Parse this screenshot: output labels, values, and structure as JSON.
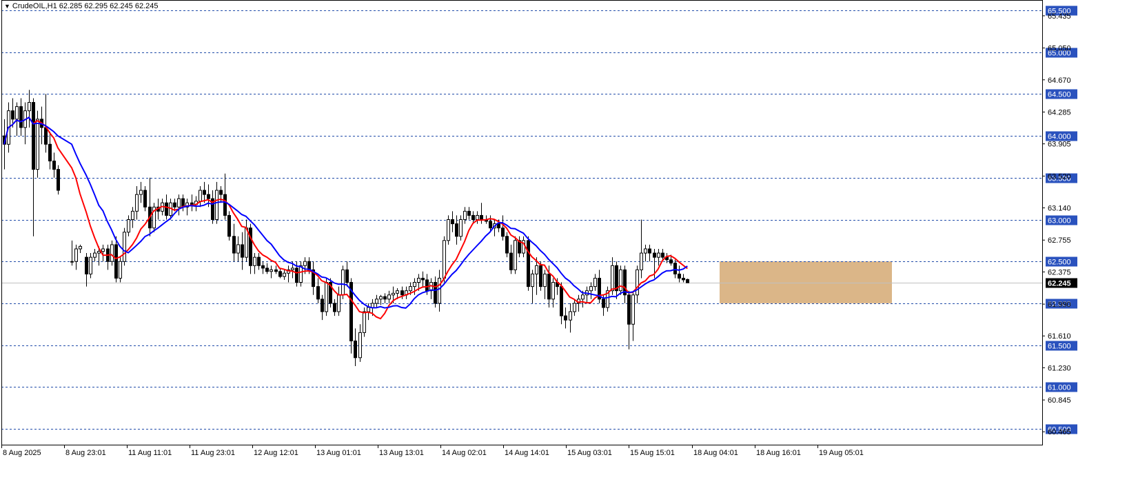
{
  "header": {
    "symbol": "CrudeOIL,H1",
    "ohlc": "62.285 62.295 62.245 62.245"
  },
  "colors": {
    "ma_fast": "#ff0000",
    "ma_slow": "#0000ff",
    "level_line": "#1f4aa8",
    "level_label_bg": "#2a52be",
    "price_line": "#c0c0c0",
    "price_label_bg": "#000000",
    "zone": "#d2a46a"
  },
  "chart_data": {
    "type": "candlestick",
    "symbol": "CrudeOIL",
    "timeframe": "H1",
    "y_range": [
      60.5,
      65.5
    ],
    "current_price": "62.245",
    "y_ticks": [
      "65.435",
      "65.050",
      "64.670",
      "64.285",
      "63.905",
      "63.520",
      "63.140",
      "62.755",
      "62.375",
      "61.990",
      "61.610",
      "61.230",
      "60.845",
      "60.465"
    ],
    "horizontal_levels": [
      "65.500",
      "65.000",
      "64.500",
      "64.000",
      "63.500",
      "63.000",
      "62.500",
      "62.000",
      "61.500",
      "61.000",
      "60.500"
    ],
    "x_labels": [
      "8 Aug 2025",
      "8 Aug 23:01",
      "11 Aug 11:01",
      "11 Aug 23:01",
      "12 Aug 12:01",
      "13 Aug 01:01",
      "13 Aug 13:01",
      "14 Aug 02:01",
      "14 Aug 14:01",
      "15 Aug 03:01",
      "15 Aug 15:01",
      "18 Aug 04:01",
      "18 Aug 16:01",
      "19 Aug 05:01"
    ],
    "candles": [
      [
        64.0,
        64.2,
        63.6,
        63.9
      ],
      [
        63.9,
        64.4,
        63.8,
        64.3
      ],
      [
        64.3,
        64.45,
        64.1,
        64.2
      ],
      [
        64.2,
        64.4,
        64.0,
        64.35
      ],
      [
        64.35,
        64.45,
        64.0,
        64.1
      ],
      [
        64.1,
        64.4,
        63.9,
        64.3
      ],
      [
        64.3,
        64.55,
        64.1,
        64.4
      ],
      [
        64.4,
        64.45,
        62.8,
        63.6
      ],
      [
        63.6,
        64.3,
        63.5,
        64.2
      ],
      [
        64.2,
        64.35,
        63.9,
        64.1
      ],
      [
        64.1,
        64.5,
        63.8,
        63.9
      ],
      [
        63.9,
        64.05,
        63.6,
        63.7
      ],
      [
        63.7,
        63.8,
        63.5,
        63.6
      ],
      [
        63.6,
        63.65,
        63.3,
        63.35
      ],
      [
        62.5,
        62.75,
        62.45,
        62.5
      ],
      [
        62.5,
        62.7,
        62.4,
        62.65
      ],
      [
        62.65,
        62.7,
        62.6,
        62.68
      ],
      [
        62.55,
        62.6,
        62.2,
        62.35
      ],
      [
        62.35,
        62.6,
        62.3,
        62.55
      ],
      [
        62.55,
        62.65,
        62.5,
        62.6
      ],
      [
        62.6,
        62.68,
        62.45,
        62.62
      ],
      [
        62.62,
        62.7,
        62.5,
        62.65
      ],
      [
        62.65,
        62.7,
        62.4,
        62.5
      ],
      [
        62.5,
        62.75,
        62.45,
        62.7
      ],
      [
        62.7,
        62.8,
        62.25,
        62.3
      ],
      [
        62.3,
        62.55,
        62.25,
        62.5
      ],
      [
        62.5,
        62.9,
        62.45,
        62.85
      ],
      [
        62.85,
        63.05,
        62.8,
        63.0
      ],
      [
        63.0,
        63.15,
        62.9,
        63.1
      ],
      [
        63.1,
        63.4,
        63.0,
        63.3
      ],
      [
        63.3,
        63.45,
        63.2,
        63.35
      ],
      [
        63.35,
        63.4,
        63.1,
        63.15
      ],
      [
        63.15,
        63.5,
        62.8,
        62.9
      ],
      [
        62.9,
        63.2,
        62.85,
        63.15
      ],
      [
        63.15,
        63.25,
        63.0,
        63.1
      ],
      [
        63.1,
        63.25,
        63.05,
        63.2
      ],
      [
        63.2,
        63.3,
        63.0,
        63.05
      ],
      [
        63.05,
        63.25,
        63.0,
        63.2
      ],
      [
        63.2,
        63.25,
        63.1,
        63.15
      ],
      [
        63.15,
        63.3,
        63.05,
        63.25
      ],
      [
        63.25,
        63.3,
        63.1,
        63.15
      ],
      [
        63.15,
        63.25,
        63.05,
        63.2
      ],
      [
        63.2,
        63.3,
        63.1,
        63.18
      ],
      [
        63.18,
        63.28,
        63.1,
        63.22
      ],
      [
        63.22,
        63.4,
        63.15,
        63.35
      ],
      [
        63.35,
        63.45,
        63.2,
        63.3
      ],
      [
        63.3,
        63.42,
        63.15,
        63.25
      ],
      [
        63.25,
        63.35,
        62.95,
        63.0
      ],
      [
        63.0,
        63.45,
        62.95,
        63.35
      ],
      [
        63.35,
        63.4,
        63.2,
        63.3
      ],
      [
        63.3,
        63.55,
        63.0,
        63.05
      ],
      [
        63.05,
        63.1,
        62.75,
        62.8
      ],
      [
        62.8,
        62.95,
        62.5,
        62.6
      ],
      [
        62.6,
        62.8,
        62.5,
        62.7
      ],
      [
        62.7,
        62.85,
        62.4,
        62.55
      ],
      [
        62.55,
        63.0,
        62.5,
        62.9
      ],
      [
        62.9,
        62.95,
        62.35,
        62.45
      ],
      [
        62.45,
        62.6,
        62.35,
        62.55
      ],
      [
        62.55,
        62.6,
        62.4,
        62.45
      ],
      [
        62.45,
        62.5,
        62.35,
        62.42
      ],
      [
        62.42,
        62.48,
        62.35,
        62.38
      ],
      [
        62.38,
        62.45,
        62.3,
        62.4
      ],
      [
        62.4,
        62.45,
        62.35,
        62.38
      ],
      [
        62.38,
        62.42,
        62.3,
        62.32
      ],
      [
        62.32,
        62.4,
        62.28,
        62.36
      ],
      [
        62.36,
        62.45,
        62.25,
        62.4
      ],
      [
        62.4,
        62.5,
        62.3,
        62.42
      ],
      [
        62.42,
        62.5,
        62.2,
        62.25
      ],
      [
        62.25,
        62.5,
        62.2,
        62.45
      ],
      [
        62.45,
        62.55,
        62.35,
        62.5
      ],
      [
        62.5,
        62.55,
        62.35,
        62.4
      ],
      [
        62.4,
        62.5,
        62.1,
        62.2
      ],
      [
        62.2,
        62.3,
        62.0,
        62.05
      ],
      [
        62.05,
        62.1,
        61.8,
        61.9
      ],
      [
        61.9,
        62.3,
        61.85,
        62.25
      ],
      [
        62.25,
        62.3,
        61.95,
        62.0
      ],
      [
        62.0,
        62.05,
        61.85,
        61.9
      ],
      [
        61.9,
        62.2,
        61.85,
        62.1
      ],
      [
        62.1,
        62.45,
        62.05,
        62.4
      ],
      [
        62.4,
        62.5,
        62.2,
        62.25
      ],
      [
        62.25,
        62.3,
        61.4,
        61.55
      ],
      [
        61.55,
        61.7,
        61.25,
        61.35
      ],
      [
        61.35,
        61.75,
        61.3,
        61.65
      ],
      [
        61.65,
        61.95,
        61.6,
        61.9
      ],
      [
        61.9,
        62.0,
        61.8,
        61.95
      ],
      [
        61.95,
        62.05,
        61.85,
        62.0
      ],
      [
        62.0,
        62.1,
        61.95,
        62.05
      ],
      [
        62.05,
        62.1,
        61.98,
        62.08
      ],
      [
        62.08,
        62.12,
        62.0,
        62.05
      ],
      [
        62.05,
        62.15,
        62.0,
        62.1
      ],
      [
        62.1,
        62.2,
        62.0,
        62.12
      ],
      [
        62.12,
        62.18,
        62.05,
        62.15
      ],
      [
        62.15,
        62.2,
        62.05,
        62.1
      ],
      [
        62.1,
        62.2,
        62.05,
        62.15
      ],
      [
        62.15,
        62.25,
        62.1,
        62.2
      ],
      [
        62.2,
        62.3,
        62.1,
        62.25
      ],
      [
        62.25,
        62.35,
        62.15,
        62.3
      ],
      [
        62.3,
        62.38,
        62.2,
        62.28
      ],
      [
        62.28,
        62.35,
        62.1,
        62.15
      ],
      [
        62.15,
        62.3,
        62.05,
        62.25
      ],
      [
        62.25,
        62.32,
        61.95,
        62.0
      ],
      [
        62.0,
        62.4,
        61.9,
        62.3
      ],
      [
        62.3,
        62.8,
        62.25,
        62.75
      ],
      [
        62.75,
        63.05,
        62.7,
        63.0
      ],
      [
        63.0,
        63.1,
        62.85,
        62.95
      ],
      [
        62.95,
        63.05,
        62.7,
        62.8
      ],
      [
        62.8,
        63.05,
        62.75,
        63.0
      ],
      [
        63.0,
        63.15,
        62.95,
        63.1
      ],
      [
        63.1,
        63.15,
        63.0,
        63.05
      ],
      [
        63.05,
        63.1,
        62.95,
        63.0
      ],
      [
        63.0,
        63.1,
        62.95,
        63.05
      ],
      [
        63.05,
        63.2,
        62.95,
        63.0
      ],
      [
        63.0,
        63.05,
        62.95,
        62.98
      ],
      [
        62.98,
        63.05,
        62.85,
        62.9
      ],
      [
        62.9,
        63.0,
        62.8,
        62.95
      ],
      [
        62.95,
        63.0,
        62.85,
        62.9
      ],
      [
        62.9,
        63.05,
        62.75,
        62.8
      ],
      [
        62.8,
        62.85,
        62.55,
        62.6
      ],
      [
        62.6,
        62.7,
        62.35,
        62.4
      ],
      [
        62.4,
        62.8,
        62.35,
        62.75
      ],
      [
        62.75,
        62.8,
        62.55,
        62.6
      ],
      [
        62.6,
        62.8,
        62.55,
        62.75
      ],
      [
        62.75,
        62.8,
        62.15,
        62.2
      ],
      [
        62.2,
        62.4,
        62.0,
        62.35
      ],
      [
        62.35,
        62.55,
        62.1,
        62.45
      ],
      [
        62.45,
        62.5,
        62.15,
        62.2
      ],
      [
        62.2,
        62.4,
        62.05,
        62.35
      ],
      [
        62.35,
        62.45,
        61.95,
        62.05
      ],
      [
        62.05,
        62.3,
        61.95,
        62.25
      ],
      [
        62.25,
        62.3,
        62.1,
        62.2
      ],
      [
        62.2,
        62.25,
        61.75,
        61.85
      ],
      [
        61.85,
        61.95,
        61.7,
        61.8
      ],
      [
        61.8,
        62.0,
        61.65,
        61.9
      ],
      [
        61.9,
        62.05,
        61.85,
        62.0
      ],
      [
        62.0,
        62.1,
        61.9,
        62.05
      ],
      [
        62.05,
        62.15,
        61.95,
        62.1
      ],
      [
        62.1,
        62.2,
        62.0,
        62.15
      ],
      [
        62.15,
        62.25,
        62.05,
        62.2
      ],
      [
        62.2,
        62.35,
        62.15,
        62.3
      ],
      [
        62.3,
        62.4,
        62.0,
        62.05
      ],
      [
        62.05,
        62.1,
        61.85,
        61.95
      ],
      [
        61.95,
        62.2,
        61.9,
        62.15
      ],
      [
        62.15,
        62.55,
        62.1,
        62.45
      ],
      [
        62.45,
        62.5,
        62.05,
        62.15
      ],
      [
        62.15,
        62.45,
        62.1,
        62.4
      ],
      [
        62.4,
        62.45,
        62.0,
        62.1
      ],
      [
        62.1,
        62.15,
        61.45,
        61.75
      ],
      [
        61.75,
        62.15,
        61.55,
        62.1
      ],
      [
        62.1,
        62.45,
        62.0,
        62.4
      ],
      [
        62.4,
        63.0,
        62.3,
        62.6
      ],
      [
        62.6,
        62.7,
        62.5,
        62.65
      ],
      [
        62.65,
        62.7,
        62.5,
        62.6
      ],
      [
        62.6,
        62.65,
        62.3,
        62.55
      ],
      [
        62.55,
        62.65,
        62.45,
        62.6
      ],
      [
        62.6,
        62.65,
        62.5,
        62.55
      ],
      [
        62.55,
        62.6,
        62.48,
        62.52
      ],
      [
        62.52,
        62.58,
        62.45,
        62.48
      ],
      [
        62.48,
        62.52,
        62.3,
        62.35
      ],
      [
        62.35,
        62.45,
        62.25,
        62.3
      ],
      [
        62.3,
        62.35,
        62.25,
        62.28
      ],
      [
        62.285,
        62.295,
        62.245,
        62.245
      ]
    ]
  }
}
